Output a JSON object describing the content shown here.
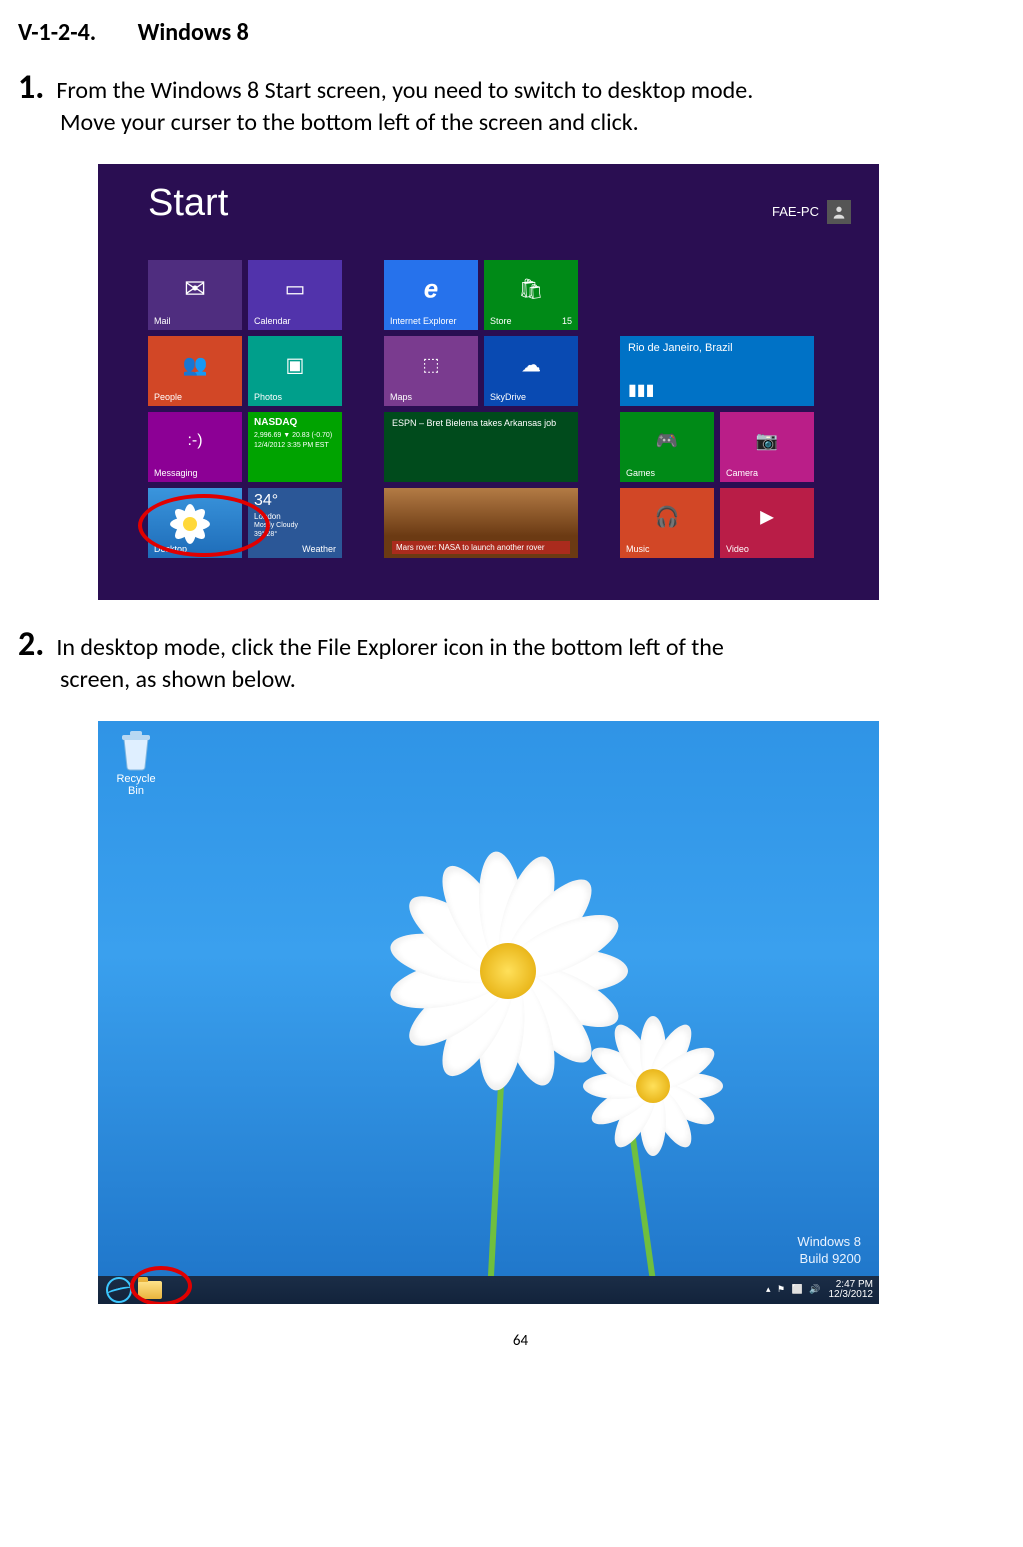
{
  "section": {
    "number": "V-1-2-4.",
    "title": "Windows 8"
  },
  "steps": {
    "s1": {
      "num": "1.",
      "line1": "From the Windows 8 Start screen, you need to switch to desktop mode.",
      "line2": "Move your curser to the bottom left of the screen and click."
    },
    "s2": {
      "num": "2.",
      "line1": "In desktop mode, click the File Explorer icon in the bottom left of the",
      "line2": "screen, as shown below."
    }
  },
  "start_screen": {
    "title": "Start",
    "user": "FAE-PC",
    "tiles": {
      "mail": "Mail",
      "calendar": "Calendar",
      "ie": "Internet Explorer",
      "store": "Store",
      "store_badge": "15",
      "people": "People",
      "photos": "Photos",
      "maps": "Maps",
      "skydrive": "SkyDrive",
      "bing_city": "Rio de Janeiro, Brazil",
      "messaging": "Messaging",
      "finance": "NASDAQ",
      "finance_sub1": "2,996.69 ▼ 20.83 (-0.70)",
      "finance_sub2": "12/4/2012 3:35 PM EST",
      "sports": "ESPN – Bret Bielema takes Arkansas job",
      "games": "Games",
      "camera": "Camera",
      "desktop": "Desktop",
      "weather": "Weather",
      "weather_temp": "34°",
      "weather_city": "London",
      "weather_cond": "Mostly Cloudy",
      "weather_range": "39°/28°",
      "news": "Mars rover: NASA to launch another rover",
      "music": "Music",
      "video": "Video"
    }
  },
  "desktop": {
    "recycle": "Recycle Bin",
    "watermark_line1": "Windows 8",
    "watermark_line2": "Build 9200",
    "time": "2:47 PM",
    "date": "12/3/2012"
  },
  "page_number": "64"
}
